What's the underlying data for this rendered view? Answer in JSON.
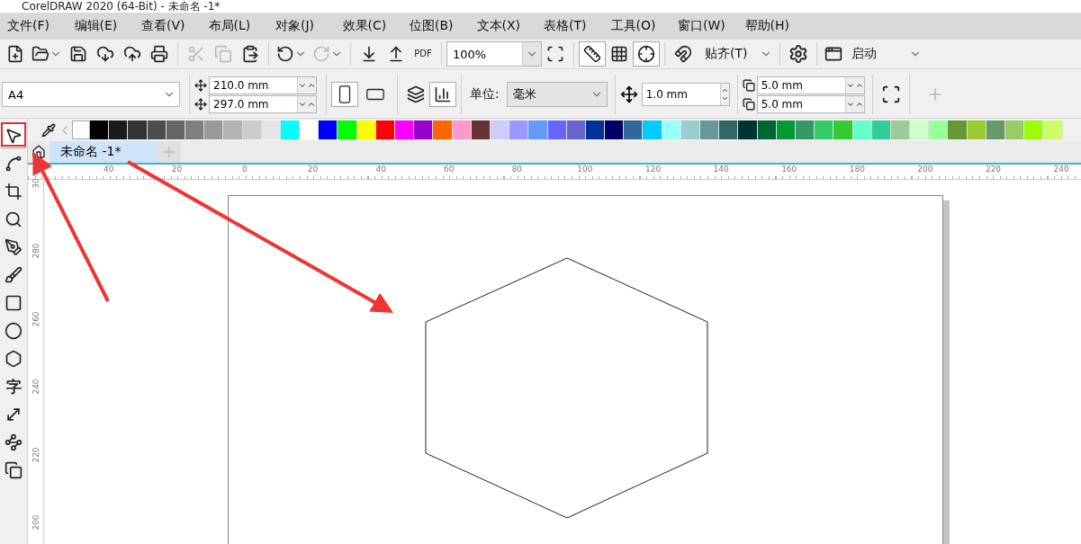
{
  "window": {
    "title": "CorelDRAW 2020 (64-Bit) - 未命名 -1*"
  },
  "menu": [
    "文件(F)",
    "编辑(E)",
    "查看(V)",
    "布局(L)",
    "对象(J)",
    "效果(C)",
    "位图(B)",
    "文本(X)",
    "表格(T)",
    "工具(O)",
    "窗口(W)",
    "帮助(H)"
  ],
  "toolbar": {
    "buttons": [
      {
        "disabled": false,
        "pressed": false
      },
      {
        "disabled": false,
        "pressed": false
      },
      {
        "disabled": false,
        "pressed": false
      },
      {
        "disabled": false,
        "pressed": false
      },
      {
        "disabled": false,
        "pressed": false
      },
      {
        "disabled": false,
        "pressed": false
      },
      {
        "disabled": true,
        "pressed": false
      },
      {
        "disabled": true,
        "pressed": false
      },
      {
        "disabled": false,
        "pressed": false
      },
      {
        "disabled": false,
        "pressed": false
      },
      {
        "disabled": true,
        "pressed": false
      },
      {
        "disabled": false,
        "pressed": false
      },
      {
        "disabled": false,
        "pressed": false
      }
    ],
    "pdf_label": "PDF",
    "zoom": "100%",
    "view_buttons": [
      {
        "pressed": true
      },
      {
        "pressed": false
      },
      {
        "pressed": true
      }
    ],
    "snap_label": "贴齐(T)",
    "launch_label": "启动"
  },
  "property_bar": {
    "page_size": "A4",
    "width": "210.0 mm",
    "height": "297.0 mm",
    "orientation": [
      {
        "selected": true
      },
      {
        "selected": false
      }
    ],
    "units_label": "单位:",
    "units": "毫米",
    "nudge": "1.0 mm",
    "duplicate_x": "5.0 mm",
    "duplicate_y": "5.0 mm"
  },
  "palette": [
    {
      "color": "#000000"
    },
    {
      "color": "#1a1a1a"
    },
    {
      "color": "#333333"
    },
    {
      "color": "#4d4d4d"
    },
    {
      "color": "#666666"
    },
    {
      "color": "#808080"
    },
    {
      "color": "#999999"
    },
    {
      "color": "#b3b3b3"
    },
    {
      "color": "#cccccc"
    },
    {
      "color": "#e6e6e6"
    },
    {
      "color": "#00ffff"
    },
    {
      "color": "#ffffff"
    },
    {
      "color": "#0000ff"
    },
    {
      "color": "#00ff00"
    },
    {
      "color": "#ffff00"
    },
    {
      "color": "#ff0000"
    },
    {
      "color": "#ff00ff"
    },
    {
      "color": "#9900cc"
    },
    {
      "color": "#ff6600"
    },
    {
      "color": "#ff99cc"
    },
    {
      "color": "#663333"
    },
    {
      "color": "#ccccff"
    },
    {
      "color": "#9999ff"
    },
    {
      "color": "#6699ff"
    },
    {
      "color": "#6666ff"
    },
    {
      "color": "#6666cc"
    },
    {
      "color": "#003399"
    },
    {
      "color": "#000066"
    },
    {
      "color": "#336699"
    },
    {
      "color": "#00ccff"
    },
    {
      "color": "#99ffff"
    },
    {
      "color": "#99cccc"
    },
    {
      "color": "#669999"
    },
    {
      "color": "#336666"
    },
    {
      "color": "#003333"
    },
    {
      "color": "#006633"
    },
    {
      "color": "#009933"
    },
    {
      "color": "#339966"
    },
    {
      "color": "#33cc66"
    },
    {
      "color": "#33cc33"
    },
    {
      "color": "#66ffcc"
    },
    {
      "color": "#33cc99"
    },
    {
      "color": "#99cc99"
    },
    {
      "color": "#ccffcc"
    },
    {
      "color": "#99ff99"
    },
    {
      "color": "#669933"
    },
    {
      "color": "#99cc33"
    },
    {
      "color": "#669966"
    },
    {
      "color": "#99cc66"
    },
    {
      "color": "#99ff00"
    },
    {
      "color": "#ccff66"
    }
  ],
  "tabs": [
    {
      "label": "未命名 -1*",
      "selected": true
    }
  ],
  "toolbox": [
    {
      "selected": true
    },
    {
      "selected": false
    },
    {
      "selected": false
    },
    {
      "selected": false
    },
    {
      "selected": false
    },
    {
      "selected": false
    },
    {
      "selected": false
    },
    {
      "selected": false
    },
    {
      "selected": false
    },
    {
      "selected": false,
      "label": "字"
    },
    {
      "selected": false
    },
    {
      "selected": false
    },
    {
      "selected": false
    }
  ],
  "ruler_h": [
    "40",
    "20",
    "0",
    "20",
    "40",
    "60",
    "80",
    "100",
    "120",
    "140",
    "160",
    "180",
    "200",
    "220",
    "240"
  ],
  "ruler_v": [
    "30",
    "280",
    "260",
    "240",
    "220",
    "200"
  ]
}
